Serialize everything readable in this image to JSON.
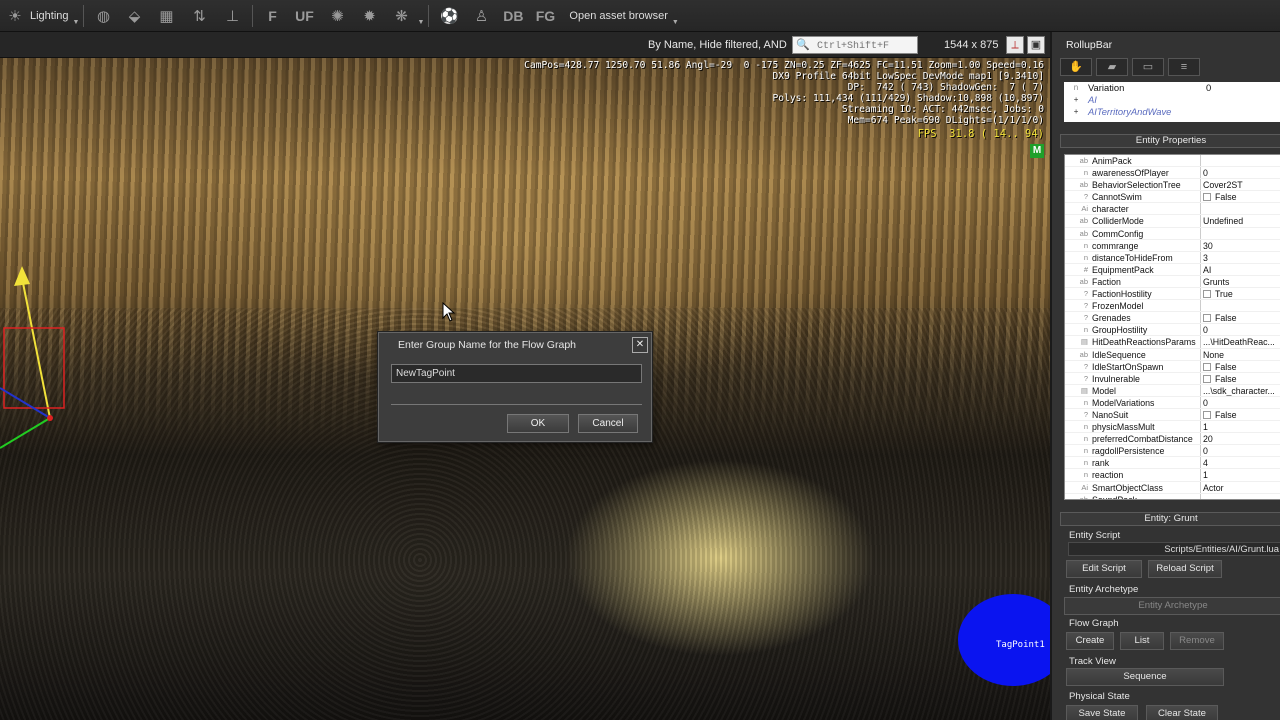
{
  "toolbar": {
    "lighting_label": "Lighting",
    "uf_label": "UF",
    "f_label": "F",
    "db_label": "DB",
    "fg_label": "FG",
    "asset_browser_label": "Open asset browser"
  },
  "filter_bar": {
    "filter_label": "By Name, Hide filtered, AND",
    "search_placeholder": "Ctrl+Shift+F",
    "resolution": "1544 x 875"
  },
  "viewport": {
    "stats_lines": [
      "CamPos=428.77 1250.70 51.86 Angl=-29  0 -175 ZN=0.25 ZF=4625 FC=11.51 Zoom=1.00 Speed=0.16",
      "DX9 Profile 64bit LowSpec DevMode map1 [9.3410]",
      "DP:  742 ( 743) ShadowGen:  7 ( 7)",
      "Polys: 111,434 (111/429) Shadow:10,898 (10,897)",
      "Streaming IO: ACT: 442msec, Jobs: 0",
      "Mem=674 Peak=690 DLights=(1/1/1/0)"
    ],
    "fps": "FPS  31.8 ( 14.. 94)",
    "m_badge": "M",
    "tagpoint_label": "TagPoint1"
  },
  "dialog": {
    "title": "Enter Group Name for the Flow Graph",
    "input_value": "NewTagPoint",
    "ok_label": "OK",
    "cancel_label": "Cancel"
  },
  "rollup": {
    "title": "RollupBar",
    "top_list": [
      {
        "icon": "n",
        "name": "Variation",
        "value": "0"
      },
      {
        "icon": "+",
        "name": "AI",
        "value": ""
      },
      {
        "icon": "+",
        "name": "AITerritoryAndWave",
        "value": ""
      }
    ],
    "entity_properties_title": "Entity Properties",
    "properties": [
      {
        "icon": "ab",
        "name": "AnimPack",
        "value": ""
      },
      {
        "icon": "n",
        "name": "awarenessOfPlayer",
        "value": "0"
      },
      {
        "icon": "ab",
        "name": "BehaviorSelectionTree",
        "value": "Cover2ST"
      },
      {
        "icon": "?",
        "name": "CannotSwim",
        "value": "False",
        "check": true
      },
      {
        "icon": "Ai",
        "name": "character",
        "value": ""
      },
      {
        "icon": "ab",
        "name": "ColliderMode",
        "value": "Undefined"
      },
      {
        "icon": "ab",
        "name": "CommConfig",
        "value": ""
      },
      {
        "icon": "n",
        "name": "commrange",
        "value": "30"
      },
      {
        "icon": "n",
        "name": "distanceToHideFrom",
        "value": "3"
      },
      {
        "icon": "#",
        "name": "EquipmentPack",
        "value": "AI"
      },
      {
        "icon": "ab",
        "name": "Faction",
        "value": "Grunts"
      },
      {
        "icon": "?",
        "name": "FactionHostility",
        "value": "True",
        "check": true
      },
      {
        "icon": "?",
        "name": "FrozenModel",
        "value": ""
      },
      {
        "icon": "?",
        "name": "Grenades",
        "value": "False",
        "check": true
      },
      {
        "icon": "n",
        "name": "GroupHostility",
        "value": "0"
      },
      {
        "icon": "▤",
        "name": "HitDeathReactionsParams",
        "value": "...\\HitDeathReac..."
      },
      {
        "icon": "ab",
        "name": "IdleSequence",
        "value": "None"
      },
      {
        "icon": "?",
        "name": "IdleStartOnSpawn",
        "value": "False",
        "check": true
      },
      {
        "icon": "?",
        "name": "Invulnerable",
        "value": "False",
        "check": true
      },
      {
        "icon": "▤",
        "name": "Model",
        "value": "...\\sdk_character..."
      },
      {
        "icon": "n",
        "name": "ModelVariations",
        "value": "0"
      },
      {
        "icon": "?",
        "name": "NanoSuit",
        "value": "False",
        "check": true
      },
      {
        "icon": "n",
        "name": "physicMassMult",
        "value": "1"
      },
      {
        "icon": "n",
        "name": "preferredCombatDistance",
        "value": "20"
      },
      {
        "icon": "n",
        "name": "ragdollPersistence",
        "value": "0"
      },
      {
        "icon": "n",
        "name": "rank",
        "value": "4"
      },
      {
        "icon": "n",
        "name": "reaction",
        "value": "1"
      },
      {
        "icon": "Ai",
        "name": "SmartObjectClass",
        "value": "Actor"
      },
      {
        "icon": "ab",
        "name": "SoundPack",
        "value": ""
      }
    ],
    "entity_title": "Entity: Grunt",
    "entity_script_label": "Entity Script",
    "script_path": "Scripts/Entities/AI/Grunt.lua",
    "edit_script_label": "Edit Script",
    "reload_script_label": "Reload Script",
    "archetype_label": "Entity Archetype",
    "archetype_button": "Entity Archetype",
    "flowgraph_label": "Flow Graph",
    "create_label": "Create",
    "list_label": "List",
    "remove_label": "Remove",
    "trackview_label": "Track View",
    "sequence_label": "Sequence",
    "physical_label": "Physical State",
    "save_state_label": "Save State",
    "clear_state_label": "Clear State"
  },
  "colors": {
    "fps_color": "#f2e23a",
    "tagpoint_color": "#0a14f0",
    "m_badge_color": "#1fa02a"
  }
}
